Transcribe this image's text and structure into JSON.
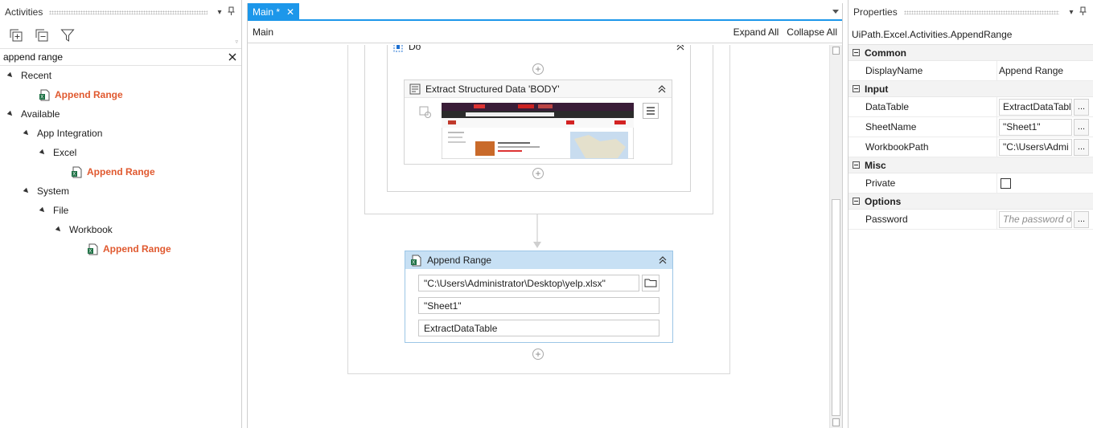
{
  "activities_panel": {
    "title": "Activities",
    "search_value": "append range",
    "tree": {
      "recent": "Recent",
      "recent_item": "Append Range",
      "available": "Available",
      "app_integration": "App Integration",
      "excel": "Excel",
      "excel_item": "Append Range",
      "system": "System",
      "file": "File",
      "workbook": "Workbook",
      "workbook_item": "Append Range"
    }
  },
  "designer": {
    "tab_label": "Main *",
    "breadcrumb": "Main",
    "expand_all": "Expand All",
    "collapse_all": "Collapse All",
    "do_label": "Do",
    "extract_title": "Extract Structured Data 'BODY'",
    "append_title": "Append Range",
    "append_fields": {
      "workbook_path": "\"C:\\Users\\Administrator\\Desktop\\yelp.xlsx\"",
      "sheet_name": "\"Sheet1\"",
      "data_table": "ExtractDataTable"
    }
  },
  "properties_panel": {
    "title": "Properties",
    "type_name": "UiPath.Excel.Activities.AppendRange",
    "categories": {
      "common": "Common",
      "input": "Input",
      "misc": "Misc",
      "options": "Options"
    },
    "rows": {
      "display_name_label": "DisplayName",
      "display_name_value": "Append Range",
      "datatable_label": "DataTable",
      "datatable_value": "ExtractDataTabl",
      "sheetname_label": "SheetName",
      "sheetname_value": "\"Sheet1\"",
      "workbookpath_label": "WorkbookPath",
      "workbookpath_value": "\"C:\\Users\\Admi",
      "private_label": "Private",
      "password_label": "Password",
      "password_placeholder": "The password o",
      "ellipsis": "..."
    }
  },
  "colors": {
    "accent": "#1c97ea",
    "activity_highlight": "#e0592f",
    "selected_header": "#c7e0f4"
  }
}
